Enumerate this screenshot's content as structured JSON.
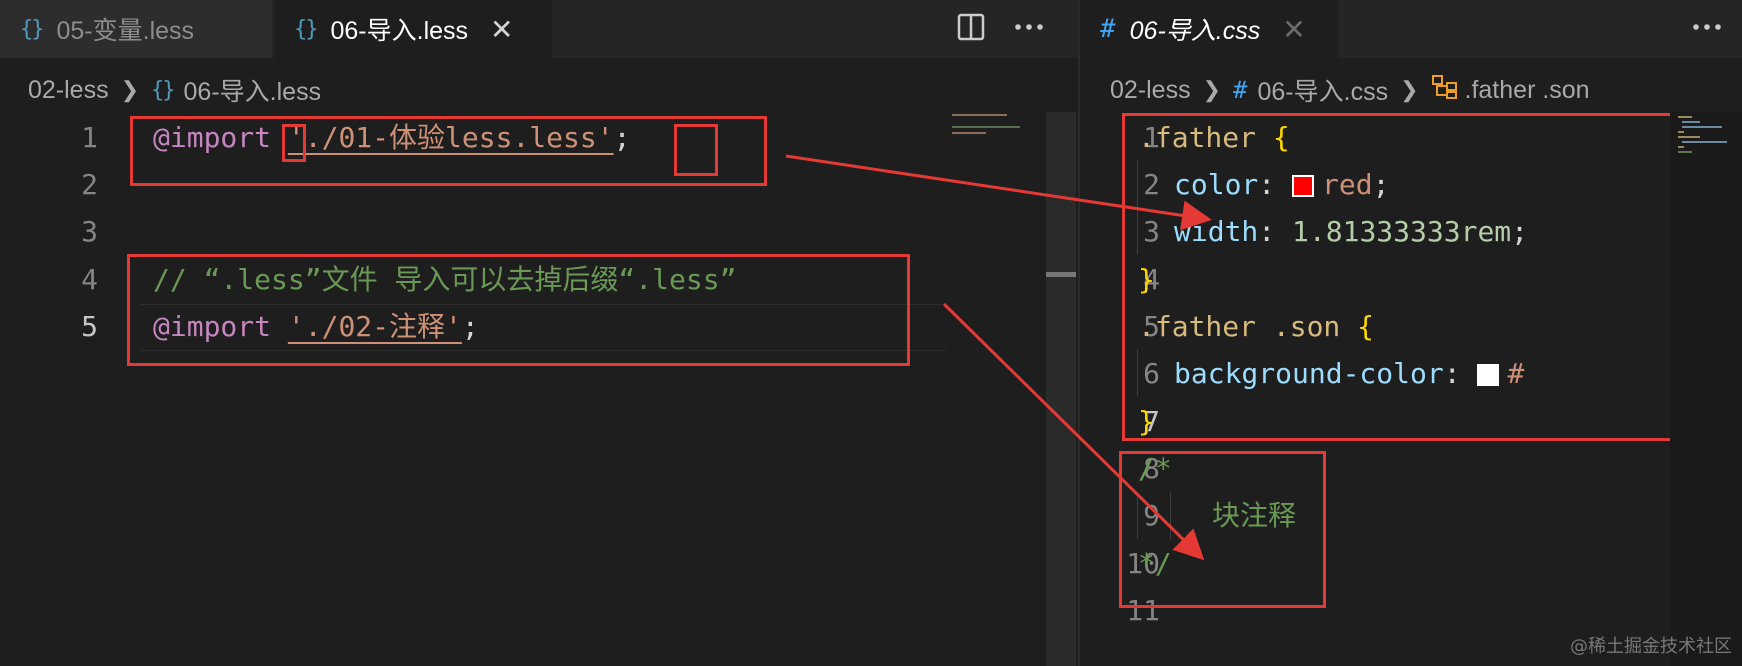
{
  "left_editor": {
    "tabs": [
      {
        "icon": "{}",
        "label": "05-变量.less",
        "active": false
      },
      {
        "icon": "{}",
        "label": "06-导入.less",
        "active": true,
        "close": "✕"
      }
    ],
    "breadcrumb": {
      "folder": "02-less",
      "file": "06-导入.less"
    },
    "lines": [
      {
        "num": "1"
      },
      {
        "num": "2"
      },
      {
        "num": "3"
      },
      {
        "num": "4"
      },
      {
        "num": "5"
      }
    ],
    "code": {
      "l1_kw": "@import",
      "l1_str": "'./01-体验less.less'",
      "l1_semi": ";",
      "l4_comment": "// “.less”文件 导入可以去掉后缀“.less”",
      "l5_kw": "@import",
      "l5_str": "'./02-注释'",
      "l5_semi": ";"
    }
  },
  "right_editor": {
    "tab": {
      "icon": "#",
      "label": "06-导入.css",
      "close": "✕"
    },
    "breadcrumb": {
      "folder": "02-less",
      "file_icon": "#",
      "file": "06-导入.css",
      "symbol": ".father .son"
    },
    "lines": [
      "1",
      "2",
      "3",
      "4",
      "5",
      "6",
      "7",
      "8",
      "9",
      "10",
      "11"
    ],
    "code": {
      "l1_sel": ".father",
      "l1_brace": "{",
      "l2_prop": "color",
      "l2_val": "red",
      "l3_prop": "width",
      "l3_val": "1.81333333rem",
      "l4_brace": "}",
      "l5_sel": ".father .son",
      "l5_brace": "{",
      "l6_prop": "background-color",
      "l6_val": "#",
      "l7_brace": "}",
      "l8_cmt": "/*",
      "l9_cmt": "块注释",
      "l10_cmt": "*/"
    },
    "swatch_colors": {
      "red": "#ff0000",
      "white": "#ffffff"
    }
  },
  "watermark": "@稀土掘金技术社区",
  "colors": {
    "annotation": "#e53935",
    "background": "#1e1e1e"
  }
}
